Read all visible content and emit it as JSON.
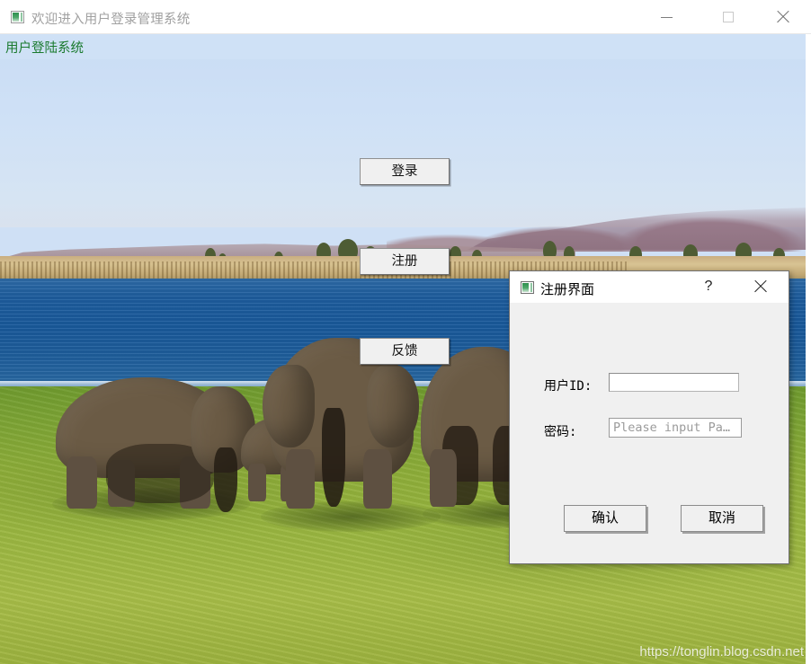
{
  "window": {
    "title": "欢迎进入用户登录管理系统",
    "icon": "app-window-icon",
    "controls": {
      "minimize": "minimize-icon",
      "maximize": "maximize-icon",
      "close": "close-icon"
    }
  },
  "header": {
    "label": "用户登陆系统",
    "label_color": "#1a7a2e",
    "strip_color": "#cfe1f6"
  },
  "main_buttons": [
    {
      "label": "登录"
    },
    {
      "label": "注册"
    },
    {
      "label": "反馈"
    }
  ],
  "watermark": "https://tonglin.blog.csdn.net",
  "dialog": {
    "title": "注册界面",
    "icon": "dialog-window-icon",
    "help_label": "?",
    "close_icon": "close-icon",
    "fields": [
      {
        "label": "用户ID:",
        "value": "",
        "placeholder": ""
      },
      {
        "label": "密码:",
        "value": "",
        "placeholder": "Please input Pa…"
      }
    ],
    "buttons": [
      {
        "label": "确认"
      },
      {
        "label": "取消"
      }
    ]
  }
}
